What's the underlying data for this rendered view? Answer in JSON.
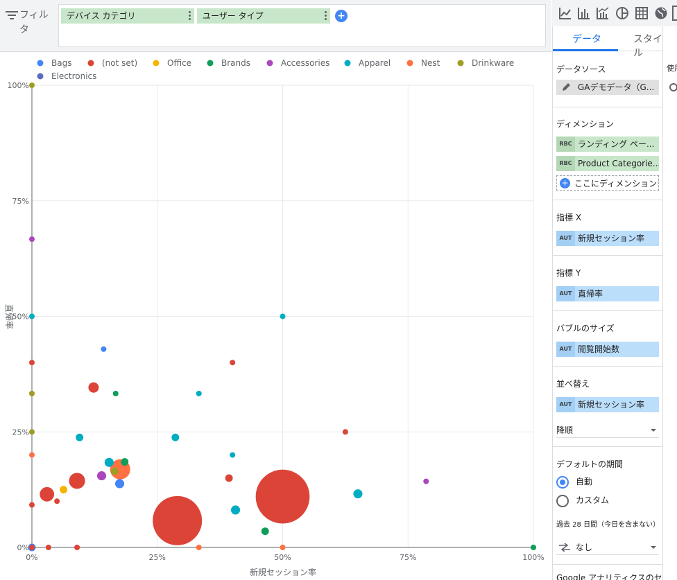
{
  "filter_bar": {
    "label": "フィルタ",
    "chips": [
      {
        "label": "デバイス カテゴリ"
      },
      {
        "label": "ユーザー タイプ"
      }
    ],
    "add_label": "+"
  },
  "toolbar": {
    "icons": [
      "line-chart-icon",
      "bar-chart-icon",
      "combo-chart-icon",
      "pie-chart-icon",
      "table-icon",
      "geo-chart-icon"
    ]
  },
  "panel": {
    "tabs": [
      {
        "label": "データ",
        "active": true
      },
      {
        "label": "スタイル",
        "active": false
      }
    ],
    "data_source": {
      "title": "データソース",
      "value": "GAデモデータ（G..."
    },
    "dimension": {
      "title": "ディメンション",
      "items": [
        {
          "tag": "RBC",
          "label": "ランディング ペー..."
        },
        {
          "tag": "RBC",
          "label": "Product Categorie..."
        }
      ],
      "add_label": "ここにディメンションを"
    },
    "metric_x": {
      "title": "指標 X",
      "tag": "AUT",
      "label": "新規セッション率"
    },
    "metric_y": {
      "title": "指標 Y",
      "tag": "AUT",
      "label": "直帰率"
    },
    "bubble_size": {
      "title": "バブルのサイズ",
      "tag": "AUT",
      "label": "閲覧開始数"
    },
    "sort": {
      "title": "並べ替え",
      "tag": "AUT",
      "label": "新規セッション率",
      "order": "降順"
    },
    "date_range": {
      "title": "デフォルトの期間",
      "options": [
        {
          "label": "自動",
          "selected": true
        },
        {
          "label": "カスタム",
          "selected": false
        }
      ],
      "note": "過去 28 日間（今日を含まない）",
      "comparison": "なし"
    },
    "ga_segment": "Google アナリティクスのセグ"
  },
  "strip": {
    "title": "使用"
  },
  "colors": {
    "accent": "#1a73e8",
    "chip_green": "#c8e6c9",
    "chip_blue": "#bbdefb"
  },
  "chart_data": {
    "type": "scatter",
    "xlabel": "新規セッション率",
    "ylabel": "直帰率",
    "xlim": [
      0,
      100
    ],
    "ylim": [
      0,
      100
    ],
    "x_ticks": [
      "0%",
      "25%",
      "50%",
      "75%",
      "100%"
    ],
    "y_ticks": [
      "0%",
      "25%",
      "50%",
      "75%",
      "100%"
    ],
    "grid": true,
    "legend_position": "top",
    "series": [
      {
        "name": "Bags",
        "color": "#4285f4",
        "points": [
          [
            14.3,
            42.9,
            1
          ],
          [
            17.5,
            13.8,
            3
          ],
          [
            0,
            0,
            2
          ]
        ]
      },
      {
        "name": "(not set)",
        "color": "#db4437",
        "points": [
          [
            50,
            11,
            120
          ],
          [
            29,
            5.8,
            100
          ],
          [
            12.3,
            34.6,
            4
          ],
          [
            9,
            14.4,
            10
          ],
          [
            3,
            11.5,
            8
          ],
          [
            5,
            10,
            1
          ],
          [
            0,
            9.2,
            1
          ],
          [
            0,
            40,
            1
          ],
          [
            40,
            40,
            1
          ],
          [
            62.5,
            25,
            1
          ],
          [
            39.3,
            15,
            2
          ],
          [
            3.3,
            0,
            1
          ],
          [
            9,
            0,
            1
          ],
          [
            0,
            0,
            1
          ]
        ]
      },
      {
        "name": "Office",
        "color": "#f4b400",
        "points": [
          [
            6.3,
            12.5,
            2
          ]
        ]
      },
      {
        "name": "Brands",
        "color": "#0f9d58",
        "points": [
          [
            16.7,
            33.3,
            1
          ],
          [
            46.5,
            3.5,
            2
          ],
          [
            100,
            0,
            1
          ],
          [
            18.5,
            18.5,
            2
          ]
        ]
      },
      {
        "name": "Accessories",
        "color": "#ab47bc",
        "points": [
          [
            0,
            66.7,
            1
          ],
          [
            13.9,
            15.5,
            3
          ],
          [
            78.6,
            14.3,
            1
          ]
        ]
      },
      {
        "name": "Apparel",
        "color": "#00acc1",
        "points": [
          [
            0,
            50,
            1
          ],
          [
            50,
            50,
            1
          ],
          [
            33.3,
            33.3,
            1
          ],
          [
            9.5,
            23.8,
            2
          ],
          [
            28.6,
            23.8,
            2
          ],
          [
            15.4,
            18.4,
            3
          ],
          [
            40,
            20,
            1
          ],
          [
            40.6,
            8.1,
            3
          ],
          [
            65,
            11.6,
            3
          ]
        ]
      },
      {
        "name": "Nest",
        "color": "#ff7043",
        "points": [
          [
            17.6,
            16.9,
            16
          ],
          [
            0,
            20,
            1
          ],
          [
            33.3,
            0,
            1
          ],
          [
            50,
            0,
            1
          ]
        ]
      },
      {
        "name": "Drinkware",
        "color": "#9e9d24",
        "points": [
          [
            0,
            100,
            1
          ],
          [
            0,
            33.3,
            1
          ],
          [
            0,
            25,
            1
          ],
          [
            16.5,
            16.5,
            2
          ]
        ]
      },
      {
        "name": "Electronics",
        "color": "#5c6bc0",
        "points": []
      }
    ]
  }
}
